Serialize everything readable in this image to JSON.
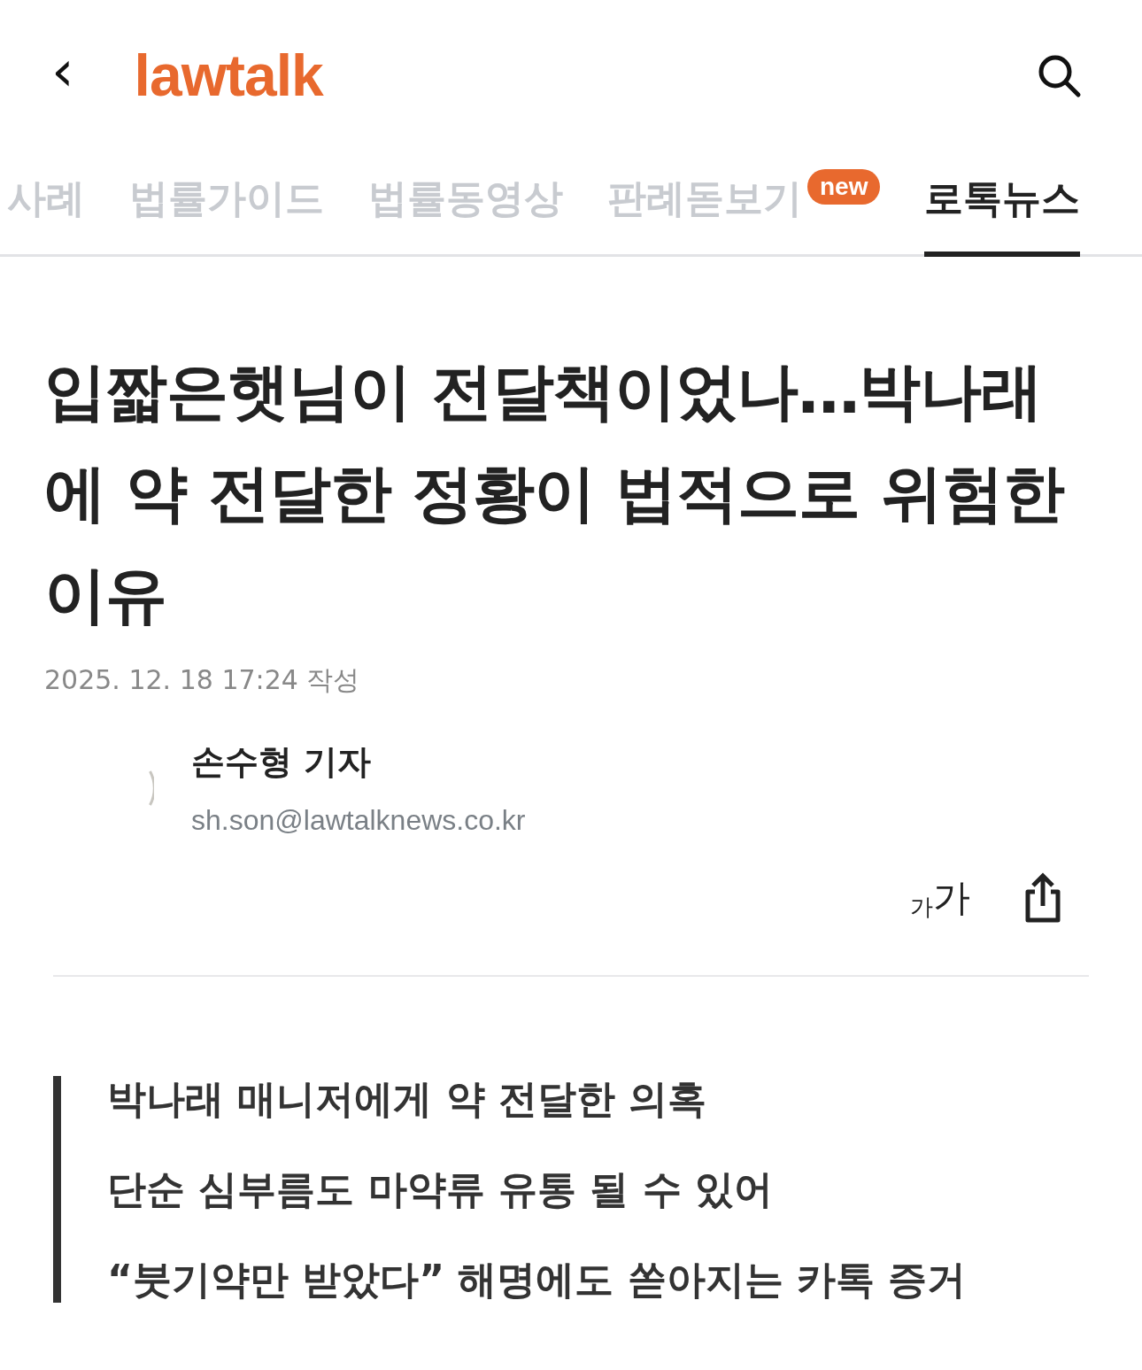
{
  "header": {
    "back_icon": "‹",
    "logo": "lawtalk"
  },
  "tabs": [
    {
      "label": "사례",
      "selected": false
    },
    {
      "label": "법률가이드",
      "selected": false
    },
    {
      "label": "법률동영상",
      "selected": false
    },
    {
      "label": "판례돋보기",
      "selected": false,
      "badge": "new"
    },
    {
      "label": "로톡뉴스",
      "selected": true
    }
  ],
  "article": {
    "title": "입짧은햇님이 전달책이었나…박나래에 약 전달한 정황이 법적으로 위험한 이유",
    "date": "2025. 12. 18 17:24 작성",
    "author": {
      "name": "손수형 기자",
      "email": "sh.son@lawtalknews.co.kr"
    },
    "font_size_button": {
      "small": "가",
      "large": "가"
    },
    "summary": [
      "박나래 매니저에게 약 전달한 의혹",
      "단순 심부름도 마약류 유통 될 수 있어",
      "“붓기약만 받았다” 해명에도 쏟아지는 카톡 증거"
    ]
  }
}
